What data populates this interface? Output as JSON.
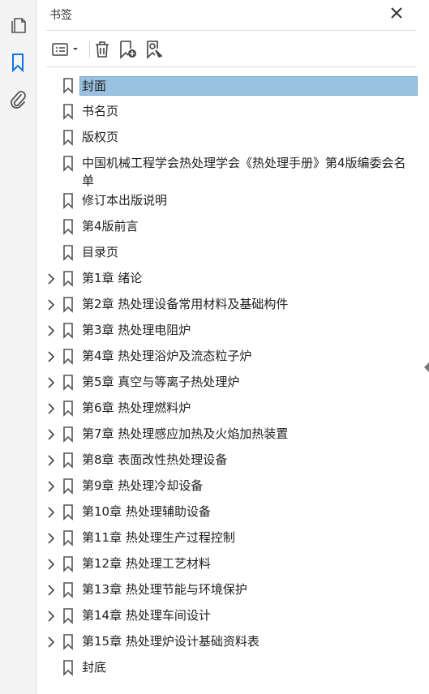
{
  "panel": {
    "title": "书签"
  },
  "rail": {
    "icons": [
      "pages-icon",
      "bookmark-icon",
      "attachment-icon"
    ]
  },
  "toolbar": {
    "options_icon": "options-list-icon",
    "delete_icon": "trash-icon",
    "new_bookmark_icon": "new-bookmark-icon",
    "bookmark_from_selection_icon": "bookmark-search-icon"
  },
  "colors": {
    "selection": "#99c2e0",
    "active_rail_icon": "#1473e6"
  },
  "bookmarks": [
    {
      "label": "封面",
      "expandable": false,
      "selected": true
    },
    {
      "label": "书名页",
      "expandable": false
    },
    {
      "label": "版权页",
      "expandable": false
    },
    {
      "label": "中国机械工程学会热处理学会《热处理手册》第4版编委会名单",
      "expandable": false
    },
    {
      "label": "修订本出版说明",
      "expandable": false
    },
    {
      "label": "第4版前言",
      "expandable": false
    },
    {
      "label": "目录页",
      "expandable": false
    },
    {
      "label": "第1章  绪论",
      "expandable": true
    },
    {
      "label": "第2章  热处理设备常用材料及基础构件",
      "expandable": true
    },
    {
      "label": "第3章  热处理电阻炉",
      "expandable": true
    },
    {
      "label": "第4章  热处理浴炉及流态粒子炉",
      "expandable": true
    },
    {
      "label": "第5章  真空与等离子热处理炉",
      "expandable": true
    },
    {
      "label": "第6章  热处理燃料炉",
      "expandable": true
    },
    {
      "label": "第7章  热处理感应加热及火焰加热装置",
      "expandable": true
    },
    {
      "label": "第8章  表面改性热处理设备",
      "expandable": true
    },
    {
      "label": "第9章  热处理冷却设备",
      "expandable": true
    },
    {
      "label": "第10章  热处理辅助设备",
      "expandable": true
    },
    {
      "label": "第11章  热处理生产过程控制",
      "expandable": true
    },
    {
      "label": "第12章  热处理工艺材料",
      "expandable": true
    },
    {
      "label": "第13章  热处理节能与环境保护",
      "expandable": true
    },
    {
      "label": "第14章  热处理车间设计",
      "expandable": true
    },
    {
      "label": "第15章  热处理炉设计基础资料表",
      "expandable": true
    },
    {
      "label": "封底",
      "expandable": false
    }
  ]
}
